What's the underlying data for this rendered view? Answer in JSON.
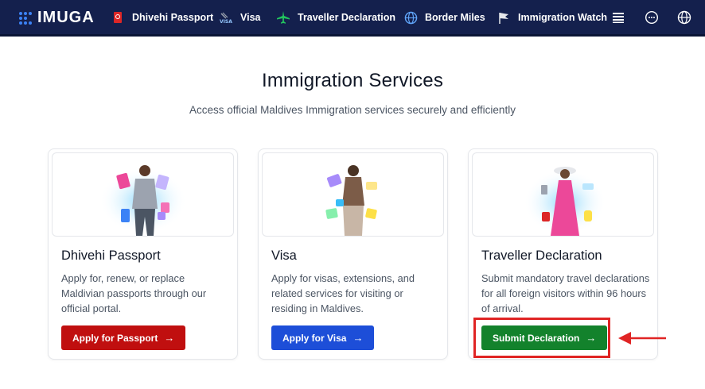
{
  "app": {
    "logo_text": "IMUGA"
  },
  "nav": {
    "items": [
      {
        "label": "Dhivehi Passport",
        "icon": "passport-icon"
      },
      {
        "label": "Visa",
        "icon": "visa-icon"
      },
      {
        "label": "Traveller Declaration",
        "icon": "airplane-icon"
      },
      {
        "label": "Border Miles",
        "icon": "globe-icon"
      },
      {
        "label": "Immigration Watch",
        "icon": "flag-icon"
      }
    ],
    "right_icons": [
      "menu-icon",
      "chat-icon",
      "language-globe-icon"
    ]
  },
  "header": {
    "title": "Immigration Services",
    "subtitle": "Access official Maldives Immigration services securely and efficiently"
  },
  "cards": [
    {
      "title": "Dhivehi Passport",
      "description": "Apply for, renew, or replace Maldivian passports through our official portal.",
      "button_label": "Apply for Passport",
      "button_color": "#c00f0f"
    },
    {
      "title": "Visa",
      "description": "Apply for visas, extensions, and related services for visiting or residing in Maldives.",
      "button_label": "Apply for Visa",
      "button_color": "#1d4ed8"
    },
    {
      "title": "Traveller Declaration",
      "description": "Submit mandatory travel declarations for all foreign visitors within 96 hours of arrival.",
      "button_label": "Submit Declaration",
      "button_color": "#13822c"
    }
  ],
  "colors": {
    "nav_bg": "#14204d",
    "annotation": "#e02424"
  }
}
